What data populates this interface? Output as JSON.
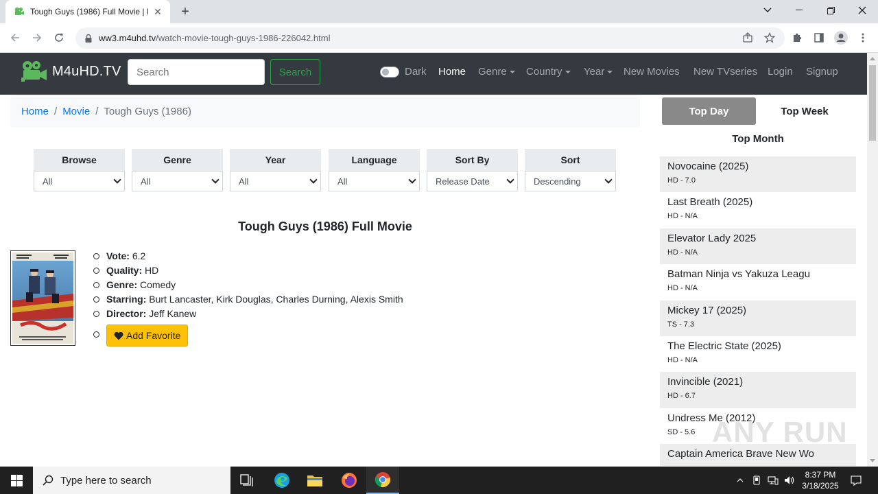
{
  "browser": {
    "tab_title": "Tough Guys (1986) Full Movie | M4uHD",
    "url_domain": "ww3.m4uhd.tv",
    "url_path": "/watch-movie-tough-guys-1986-226042.html"
  },
  "site": {
    "logo_text": "M4uHD.TV",
    "search_placeholder": "Search",
    "search_button": "Search",
    "dark_label": "Dark",
    "nav": {
      "home": "Home",
      "genre": "Genre",
      "country": "Country",
      "year": "Year",
      "new_movies": "New Movies",
      "new_tvseries": "New TVseries",
      "login": "Login",
      "signup": "Signup"
    }
  },
  "breadcrumb": {
    "home": "Home",
    "movie": "Movie",
    "current": "Tough Guys (1986)",
    "separator": "/"
  },
  "filters": [
    {
      "label": "Browse",
      "value": "All"
    },
    {
      "label": "Genre",
      "value": "All"
    },
    {
      "label": "Year",
      "value": "All"
    },
    {
      "label": "Language",
      "value": "All"
    },
    {
      "label": "Sort By",
      "value": "Release Date"
    },
    {
      "label": "Sort",
      "value": "Descending"
    }
  ],
  "movie": {
    "title": "Tough Guys (1986) Full Movie",
    "vote_label": "Vote:",
    "vote": "6.2",
    "quality_label": "Quality:",
    "quality": "HD",
    "genre_label": "Genre:",
    "genre": "Comedy",
    "starring_label": "Starring:",
    "starring": "Burt Lancaster, Kirk Douglas, Charles Durning, Alexis Smith",
    "director_label": "Director:",
    "director": "Jeff Kanew",
    "favorite_button": "Add Favorite"
  },
  "sidebar": {
    "top_day": "Top Day",
    "top_week": "Top Week",
    "top_month": "Top Month",
    "items": [
      {
        "name": "Novocaine (2025)",
        "meta": "HD - 7.0"
      },
      {
        "name": "Last Breath (2025)",
        "meta": "HD - N/A"
      },
      {
        "name": "Elevator Lady 2025",
        "meta": "HD - N/A"
      },
      {
        "name": "Batman Ninja vs Yakuza Leagu",
        "meta": "HD - N/A"
      },
      {
        "name": "Mickey 17 (2025)",
        "meta": "TS - 7.3"
      },
      {
        "name": "The Electric State (2025)",
        "meta": "HD - N/A"
      },
      {
        "name": "Invincible (2021)",
        "meta": "HD - 6.7"
      },
      {
        "name": "Undress Me (2012)",
        "meta": "SD - 5.6"
      },
      {
        "name": "Captain America Brave New Wo",
        "meta": ""
      }
    ]
  },
  "watermark": "ANY RUN",
  "taskbar": {
    "search_placeholder": "Type here to search",
    "time": "8:37 PM",
    "date": "3/18/2025"
  },
  "colors": {
    "navbar_bg": "#343a40",
    "accent_green": "#28a745",
    "link_blue": "#007bff",
    "favorite_yellow": "#ffc107",
    "top_day_bg": "#898989"
  }
}
